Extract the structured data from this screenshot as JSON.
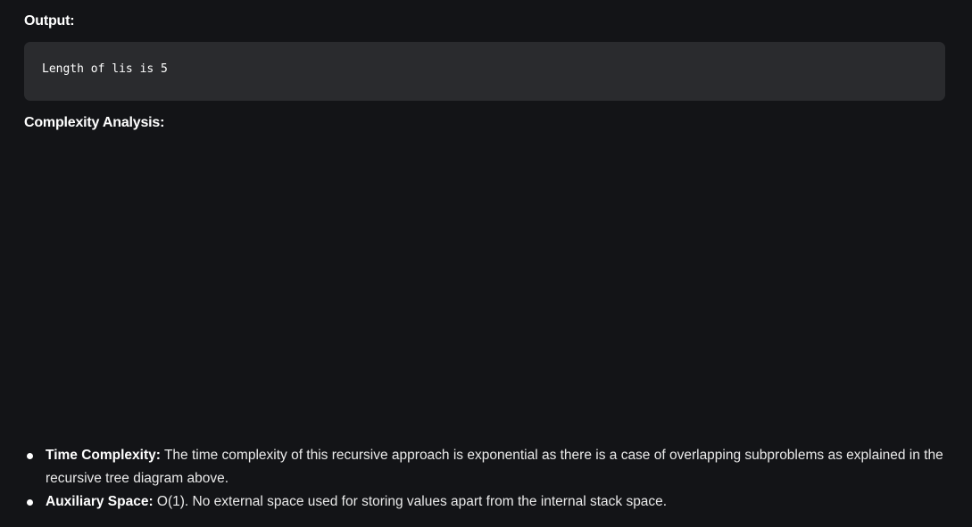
{
  "output": {
    "heading": "Output:",
    "code": "Length of lis is 5"
  },
  "complexity": {
    "heading": "Complexity Analysis:",
    "items": [
      {
        "label": "Time Complexity:",
        "text": " The time complexity of this recursive approach is exponential as there is a case of overlapping subproblems as explained in the recursive tree diagram above."
      },
      {
        "label": "Auxiliary Space:",
        "text": " O(1). No external space used for storing values apart from the internal stack space."
      }
    ]
  }
}
